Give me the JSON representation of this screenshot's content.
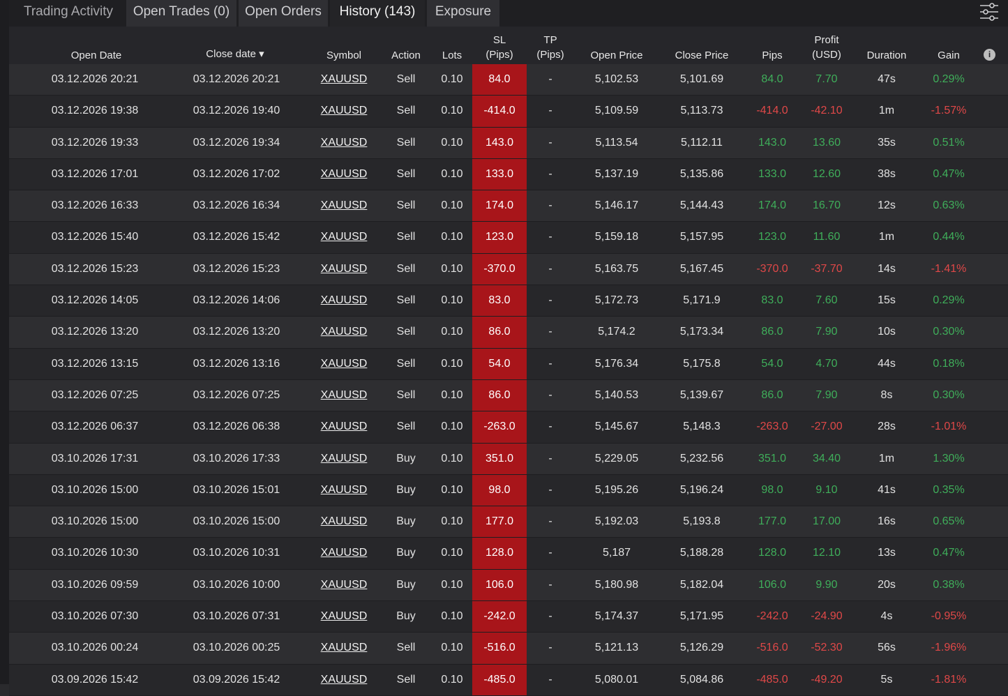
{
  "tabs": [
    {
      "label": "Trading Activity"
    },
    {
      "label": "Open Trades (0)"
    },
    {
      "label": "Open Orders"
    },
    {
      "label": "History (143)"
    },
    {
      "label": "Exposure"
    }
  ],
  "columns": {
    "open_date": "Open Date",
    "close_date": "Close date ▾",
    "symbol": "Symbol",
    "action": "Action",
    "lots": "Lots",
    "sl_1": "SL",
    "sl_2": "(Pips)",
    "tp_1": "TP",
    "tp_2": "(Pips)",
    "open_price": "Open Price",
    "close_price": "Close Price",
    "pips": "Pips",
    "profit_1": "Profit",
    "profit_2": "(USD)",
    "duration": "Duration",
    "gain": "Gain"
  },
  "info_icon_glyph": "i",
  "colors": {
    "positive": "#3fae5a",
    "negative": "#e04848",
    "sl_highlight": "#a8151a"
  },
  "rows": [
    {
      "open": "03.12.2026 20:21",
      "close": "03.12.2026 20:21",
      "symbol": "XAUUSD",
      "action": "Sell",
      "lots": "0.10",
      "sl": "84.0",
      "tp": "-",
      "open_price": "5,102.53",
      "close_price": "5,101.69",
      "pips": "84.0",
      "profit": "7.70",
      "duration": "47s",
      "gain": "0.29%"
    },
    {
      "open": "03.12.2026 19:38",
      "close": "03.12.2026 19:40",
      "symbol": "XAUUSD",
      "action": "Sell",
      "lots": "0.10",
      "sl": "-414.0",
      "tp": "-",
      "open_price": "5,109.59",
      "close_price": "5,113.73",
      "pips": "-414.0",
      "profit": "-42.10",
      "duration": "1m",
      "gain": "-1.57%"
    },
    {
      "open": "03.12.2026 19:33",
      "close": "03.12.2026 19:34",
      "symbol": "XAUUSD",
      "action": "Sell",
      "lots": "0.10",
      "sl": "143.0",
      "tp": "-",
      "open_price": "5,113.54",
      "close_price": "5,112.11",
      "pips": "143.0",
      "profit": "13.60",
      "duration": "35s",
      "gain": "0.51%"
    },
    {
      "open": "03.12.2026 17:01",
      "close": "03.12.2026 17:02",
      "symbol": "XAUUSD",
      "action": "Sell",
      "lots": "0.10",
      "sl": "133.0",
      "tp": "-",
      "open_price": "5,137.19",
      "close_price": "5,135.86",
      "pips": "133.0",
      "profit": "12.60",
      "duration": "38s",
      "gain": "0.47%"
    },
    {
      "open": "03.12.2026 16:33",
      "close": "03.12.2026 16:34",
      "symbol": "XAUUSD",
      "action": "Sell",
      "lots": "0.10",
      "sl": "174.0",
      "tp": "-",
      "open_price": "5,146.17",
      "close_price": "5,144.43",
      "pips": "174.0",
      "profit": "16.70",
      "duration": "12s",
      "gain": "0.63%"
    },
    {
      "open": "03.12.2026 15:40",
      "close": "03.12.2026 15:42",
      "symbol": "XAUUSD",
      "action": "Sell",
      "lots": "0.10",
      "sl": "123.0",
      "tp": "-",
      "open_price": "5,159.18",
      "close_price": "5,157.95",
      "pips": "123.0",
      "profit": "11.60",
      "duration": "1m",
      "gain": "0.44%"
    },
    {
      "open": "03.12.2026 15:23",
      "close": "03.12.2026 15:23",
      "symbol": "XAUUSD",
      "action": "Sell",
      "lots": "0.10",
      "sl": "-370.0",
      "tp": "-",
      "open_price": "5,163.75",
      "close_price": "5,167.45",
      "pips": "-370.0",
      "profit": "-37.70",
      "duration": "14s",
      "gain": "-1.41%"
    },
    {
      "open": "03.12.2026 14:05",
      "close": "03.12.2026 14:06",
      "symbol": "XAUUSD",
      "action": "Sell",
      "lots": "0.10",
      "sl": "83.0",
      "tp": "-",
      "open_price": "5,172.73",
      "close_price": "5,171.9",
      "pips": "83.0",
      "profit": "7.60",
      "duration": "15s",
      "gain": "0.29%"
    },
    {
      "open": "03.12.2026 13:20",
      "close": "03.12.2026 13:20",
      "symbol": "XAUUSD",
      "action": "Sell",
      "lots": "0.10",
      "sl": "86.0",
      "tp": "-",
      "open_price": "5,174.2",
      "close_price": "5,173.34",
      "pips": "86.0",
      "profit": "7.90",
      "duration": "10s",
      "gain": "0.30%"
    },
    {
      "open": "03.12.2026 13:15",
      "close": "03.12.2026 13:16",
      "symbol": "XAUUSD",
      "action": "Sell",
      "lots": "0.10",
      "sl": "54.0",
      "tp": "-",
      "open_price": "5,176.34",
      "close_price": "5,175.8",
      "pips": "54.0",
      "profit": "4.70",
      "duration": "44s",
      "gain": "0.18%"
    },
    {
      "open": "03.12.2026 07:25",
      "close": "03.12.2026 07:25",
      "symbol": "XAUUSD",
      "action": "Sell",
      "lots": "0.10",
      "sl": "86.0",
      "tp": "-",
      "open_price": "5,140.53",
      "close_price": "5,139.67",
      "pips": "86.0",
      "profit": "7.90",
      "duration": "8s",
      "gain": "0.30%"
    },
    {
      "open": "03.12.2026 06:37",
      "close": "03.12.2026 06:38",
      "symbol": "XAUUSD",
      "action": "Sell",
      "lots": "0.10",
      "sl": "-263.0",
      "tp": "-",
      "open_price": "5,145.67",
      "close_price": "5,148.3",
      "pips": "-263.0",
      "profit": "-27.00",
      "duration": "28s",
      "gain": "-1.01%"
    },
    {
      "open": "03.10.2026 17:31",
      "close": "03.10.2026 17:33",
      "symbol": "XAUUSD",
      "action": "Buy",
      "lots": "0.10",
      "sl": "351.0",
      "tp": "-",
      "open_price": "5,229.05",
      "close_price": "5,232.56",
      "pips": "351.0",
      "profit": "34.40",
      "duration": "1m",
      "gain": "1.30%"
    },
    {
      "open": "03.10.2026 15:00",
      "close": "03.10.2026 15:01",
      "symbol": "XAUUSD",
      "action": "Buy",
      "lots": "0.10",
      "sl": "98.0",
      "tp": "-",
      "open_price": "5,195.26",
      "close_price": "5,196.24",
      "pips": "98.0",
      "profit": "9.10",
      "duration": "41s",
      "gain": "0.35%"
    },
    {
      "open": "03.10.2026 15:00",
      "close": "03.10.2026 15:00",
      "symbol": "XAUUSD",
      "action": "Buy",
      "lots": "0.10",
      "sl": "177.0",
      "tp": "-",
      "open_price": "5,192.03",
      "close_price": "5,193.8",
      "pips": "177.0",
      "profit": "17.00",
      "duration": "16s",
      "gain": "0.65%"
    },
    {
      "open": "03.10.2026 10:30",
      "close": "03.10.2026 10:31",
      "symbol": "XAUUSD",
      "action": "Buy",
      "lots": "0.10",
      "sl": "128.0",
      "tp": "-",
      "open_price": "5,187",
      "close_price": "5,188.28",
      "pips": "128.0",
      "profit": "12.10",
      "duration": "13s",
      "gain": "0.47%"
    },
    {
      "open": "03.10.2026 09:59",
      "close": "03.10.2026 10:00",
      "symbol": "XAUUSD",
      "action": "Buy",
      "lots": "0.10",
      "sl": "106.0",
      "tp": "-",
      "open_price": "5,180.98",
      "close_price": "5,182.04",
      "pips": "106.0",
      "profit": "9.90",
      "duration": "20s",
      "gain": "0.38%"
    },
    {
      "open": "03.10.2026 07:30",
      "close": "03.10.2026 07:31",
      "symbol": "XAUUSD",
      "action": "Buy",
      "lots": "0.10",
      "sl": "-242.0",
      "tp": "-",
      "open_price": "5,174.37",
      "close_price": "5,171.95",
      "pips": "-242.0",
      "profit": "-24.90",
      "duration": "4s",
      "gain": "-0.95%"
    },
    {
      "open": "03.10.2026 00:24",
      "close": "03.10.2026 00:25",
      "symbol": "XAUUSD",
      "action": "Sell",
      "lots": "0.10",
      "sl": "-516.0",
      "tp": "-",
      "open_price": "5,121.13",
      "close_price": "5,126.29",
      "pips": "-516.0",
      "profit": "-52.30",
      "duration": "56s",
      "gain": "-1.96%"
    },
    {
      "open": "03.09.2026 15:42",
      "close": "03.09.2026 15:42",
      "symbol": "XAUUSD",
      "action": "Sell",
      "lots": "0.10",
      "sl": "-485.0",
      "tp": "-",
      "open_price": "5,080.01",
      "close_price": "5,084.86",
      "pips": "-485.0",
      "profit": "-49.20",
      "duration": "5s",
      "gain": "-1.81%"
    }
  ]
}
